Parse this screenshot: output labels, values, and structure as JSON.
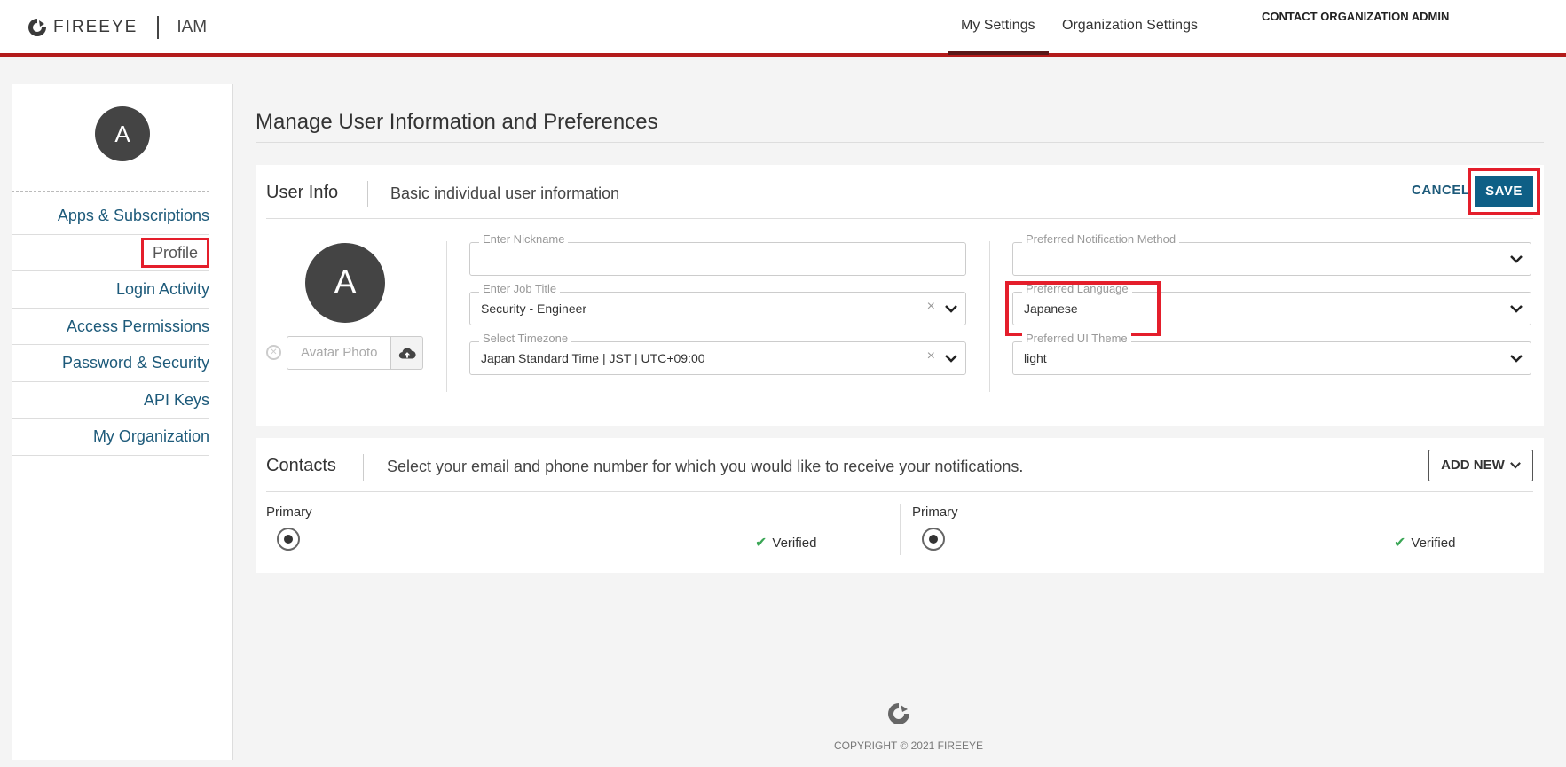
{
  "header": {
    "brand": "FIREEYE",
    "app": "IAM",
    "nav": [
      "My Settings",
      "Organization Settings"
    ],
    "contact_admin": "CONTACT ORGANIZATION ADMIN"
  },
  "sidebar": {
    "avatar_initial": "A",
    "items": [
      {
        "label": "Apps & Subscriptions"
      },
      {
        "label": "Profile"
      },
      {
        "label": "Login Activity"
      },
      {
        "label": "Access Permissions"
      },
      {
        "label": "Password & Security"
      },
      {
        "label": "API Keys"
      },
      {
        "label": "My Organization"
      }
    ],
    "active_item": "Profile"
  },
  "main": {
    "title": "Manage User Information and Preferences"
  },
  "user_info": {
    "title": "User Info",
    "description": "Basic individual user information",
    "cancel_label": "CANCEL",
    "save_label": "SAVE",
    "avatar_initial": "A",
    "avatar_placeholder": "Avatar Photo",
    "fields": {
      "nickname": {
        "label": "Enter Nickname",
        "value": ""
      },
      "job_title": {
        "label": "Enter Job Title",
        "value": "Security - Engineer"
      },
      "timezone": {
        "label": "Select Timezone",
        "value": "Japan Standard Time | JST | UTC+09:00"
      },
      "notification": {
        "label": "Preferred Notification Method",
        "value": ""
      },
      "language": {
        "label": "Preferred Language",
        "value": "Japanese"
      },
      "theme": {
        "label": "Preferred UI Theme",
        "value": "light"
      }
    }
  },
  "contacts": {
    "title": "Contacts",
    "description": "Select your email and phone number for which you would like to receive your notifications.",
    "add_new_label": "ADD NEW",
    "items": [
      {
        "label": "Primary",
        "status": "Verified"
      },
      {
        "label": "Primary",
        "status": "Verified"
      }
    ]
  },
  "footer": {
    "copyright": "COPYRIGHT © 2021 FIREEYE"
  },
  "colors": {
    "accent_red": "#b31b1b",
    "highlight_red": "#e41e2b",
    "link_blue": "#1d5a7a",
    "save_blue": "#0e5f86",
    "verified_green": "#3aa655"
  }
}
